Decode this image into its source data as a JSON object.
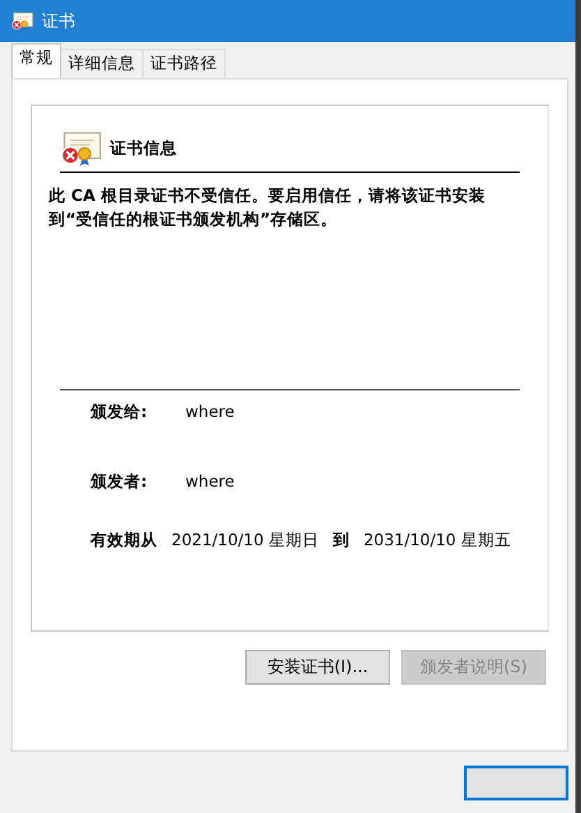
{
  "window": {
    "title": "证书"
  },
  "tabs": [
    {
      "label": "常规",
      "selected": true
    },
    {
      "label": "详细信息",
      "selected": false
    },
    {
      "label": "证书路径",
      "selected": false
    }
  ],
  "cert_info": {
    "heading": "证书信息",
    "message": "此 CA 根目录证书不受信任。要启用信任，请将该证书安装到“受信任的根证书颁发机构”存储区。"
  },
  "fields": [
    {
      "label": "颁发给:",
      "value": "where"
    },
    {
      "label": "颁发者:",
      "value": "where"
    }
  ],
  "validity": {
    "label": "有效期从",
    "from": "2021/10/10 星期日",
    "to_label": "到",
    "to": "2031/10/10 星期五"
  },
  "buttons": [
    {
      "label": "安装证书(I)...",
      "disabled": false
    },
    {
      "label": "颁发者说明(S)",
      "disabled": true
    }
  ],
  "ok_button": {
    "default": true
  }
}
